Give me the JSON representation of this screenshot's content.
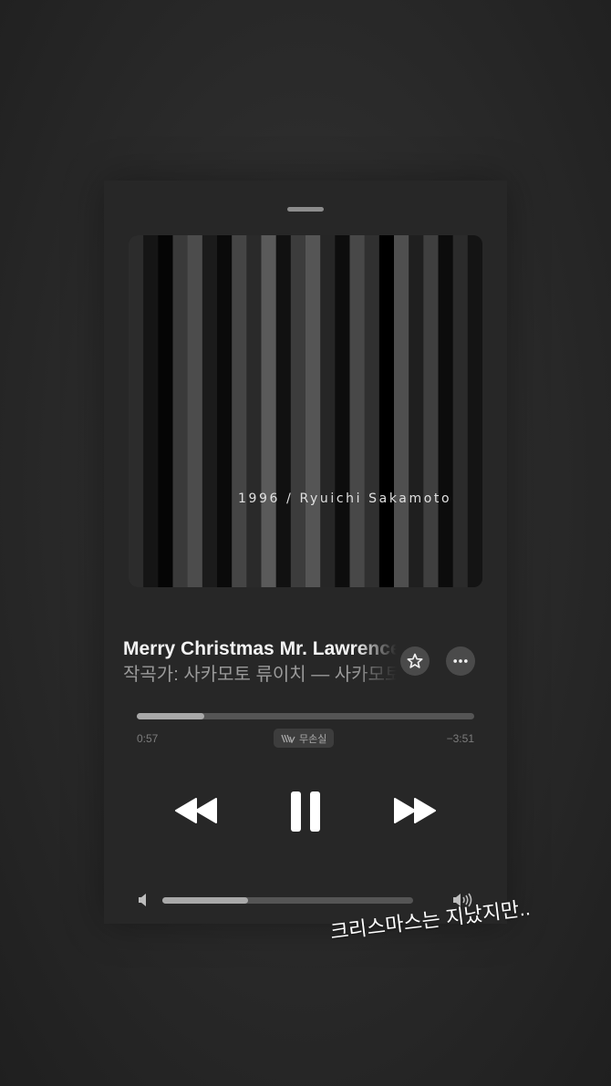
{
  "album_art": {
    "caption": "1996 / Ryuichi Sakamoto",
    "stripes": [
      "#2c2c2c",
      "#151515",
      "#050505",
      "#3a3a3a",
      "#4c4c4c",
      "#1b1b1b",
      "#0a0a0a",
      "#454545",
      "#2a2a2a",
      "#5a5a5a",
      "#111111",
      "#3c3c3c",
      "#555555",
      "#262626",
      "#0d0d0d",
      "#484848",
      "#303030",
      "#000000",
      "#4f4f4f",
      "#1f1f1f",
      "#3f3f3f",
      "#0c0c0c",
      "#2b2b2b",
      "#141414"
    ]
  },
  "track": {
    "title": "Merry Christmas Mr. Lawrence",
    "subtitle": "작곡가: 사카모토 류이치 — 사카모토 류이치"
  },
  "buttons": {
    "favorite_icon": "star-icon",
    "more_icon": "ellipsis-icon"
  },
  "playback": {
    "elapsed": "0:57",
    "remaining": "−3:51",
    "progress": 0.2,
    "quality_badge": "무손실"
  },
  "volume": {
    "level": 0.34
  },
  "story_caption": "크리스마스는 지났지만..",
  "colors": {
    "card_background": "#272727",
    "accent_fill": "#a9a9a9",
    "track": "#555555"
  }
}
